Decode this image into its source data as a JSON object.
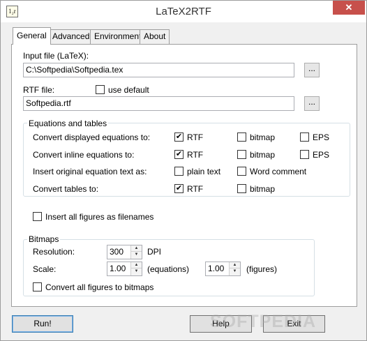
{
  "window": {
    "title": "LaTeX2RTF",
    "icon_text": "1₂r",
    "close_glyph": "✕"
  },
  "tabs": [
    {
      "label": "General",
      "active": true
    },
    {
      "label": "Advanced",
      "active": false
    },
    {
      "label": "Environment",
      "active": false
    },
    {
      "label": "About",
      "active": false
    }
  ],
  "general": {
    "input_file_label": "Input file (LaTeX):",
    "input_file_value": "C:\\Softpedia\\Softpedia.tex",
    "browse_label": "...",
    "rtf_file_label": "RTF file:",
    "use_default_label": "use default",
    "use_default_checked": false,
    "rtf_file_value": "Softpedia.rtf",
    "equations_group_title": "Equations and tables",
    "rows": [
      {
        "label": "Convert displayed equations to:",
        "options": [
          {
            "label": "RTF",
            "checked": true
          },
          {
            "label": "bitmap",
            "checked": false
          },
          {
            "label": "EPS",
            "checked": false
          }
        ]
      },
      {
        "label": "Convert inline equations to:",
        "options": [
          {
            "label": "RTF",
            "checked": true
          },
          {
            "label": "bitmap",
            "checked": false
          },
          {
            "label": "EPS",
            "checked": false
          }
        ]
      },
      {
        "label": "Insert original equation text as:",
        "options": [
          {
            "label": "plain text",
            "checked": false
          },
          {
            "label": "Word comment",
            "checked": false
          }
        ]
      },
      {
        "label": "Convert tables to:",
        "options": [
          {
            "label": "RTF",
            "checked": true
          },
          {
            "label": "bitmap",
            "checked": false
          }
        ]
      }
    ],
    "insert_figures_label": "Insert all figures as filenames",
    "insert_figures_checked": false,
    "bitmaps_group_title": "Bitmaps",
    "resolution_label": "Resolution:",
    "resolution_value": "300",
    "dpi_label": "DPI",
    "scale_label": "Scale:",
    "scale_equations_value": "1.00",
    "equations_label": "(equations)",
    "scale_figures_value": "1.00",
    "figures_label": "(figures)",
    "convert_figures_label": "Convert all figures to bitmaps",
    "convert_figures_checked": false
  },
  "buttons": {
    "run": "Run!",
    "help": "Help",
    "exit": "Exit"
  },
  "glyphs": {
    "check": "✔",
    "spin_up": "▲",
    "spin_down": "▼"
  },
  "watermark": "SOFTPEDIA"
}
